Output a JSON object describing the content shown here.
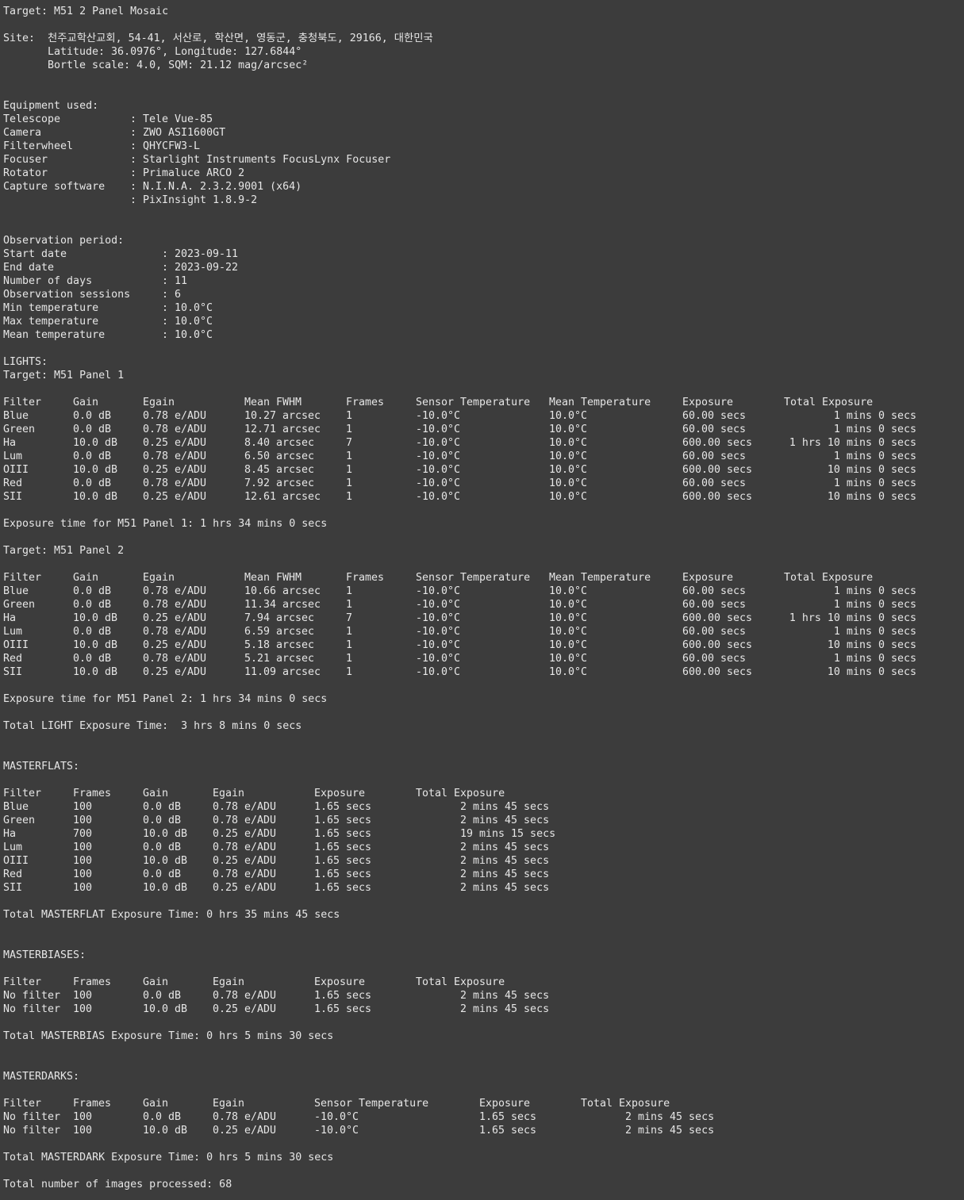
{
  "target_line": "Target: M51 2 Panel Mosaic",
  "site": {
    "label": "Site:",
    "address": "천주교학산교회, 54-41, 서산로, 학산면, 영동군, 충청북도, 29166, 대한민국",
    "coords": "Latitude: 36.0976°, Longitude: 127.6844°",
    "bortle": "Bortle scale: 4.0, SQM: 21.12 mag/arcsec²"
  },
  "equipment": {
    "heading": "Equipment used:",
    "items": [
      {
        "label": "Telescope",
        "value": ": Tele Vue-85"
      },
      {
        "label": "Camera",
        "value": ": ZWO ASI1600GT"
      },
      {
        "label": "Filterwheel",
        "value": ": QHYCFW3-L"
      },
      {
        "label": "Focuser",
        "value": ": Starlight Instruments FocusLynx Focuser"
      },
      {
        "label": "Rotator",
        "value": ": Primaluce ARCO 2"
      },
      {
        "label": "Capture software",
        "value": ": N.I.N.A. 2.3.2.9001 (x64)"
      },
      {
        "label": "",
        "value": ": PixInsight 1.8.9-2"
      }
    ]
  },
  "observation": {
    "heading": "Observation period:",
    "items": [
      {
        "label": "Start date",
        "value": ": 2023-09-11"
      },
      {
        "label": "End date",
        "value": ": 2023-09-22"
      },
      {
        "label": "Number of days",
        "value": ": 11"
      },
      {
        "label": "Observation sessions",
        "value": ": 6"
      },
      {
        "label": "Min temperature",
        "value": ": 10.0°C"
      },
      {
        "label": "Max temperature",
        "value": ": 10.0°C"
      },
      {
        "label": "Mean temperature",
        "value": ": 10.0°C"
      }
    ]
  },
  "lights": {
    "heading": "LIGHTS:",
    "headers": [
      "Filter",
      "Gain",
      "Egain",
      "Mean FWHM",
      "Frames",
      "Sensor Temperature",
      "Mean Temperature",
      "Exposure",
      "Total Exposure"
    ],
    "panels": [
      {
        "target": "Target: M51 Panel 1",
        "rows": [
          [
            "Blue",
            "0.0 dB",
            "0.78 e/ADU",
            "10.27 arcsec",
            "1",
            "-10.0°C",
            "10.0°C",
            "60.00 secs",
            "1 mins 0 secs"
          ],
          [
            "Green",
            "0.0 dB",
            "0.78 e/ADU",
            "12.71 arcsec",
            "1",
            "-10.0°C",
            "10.0°C",
            "60.00 secs",
            "1 mins 0 secs"
          ],
          [
            "Ha",
            "10.0 dB",
            "0.25 e/ADU",
            "8.40 arcsec",
            "7",
            "-10.0°C",
            "10.0°C",
            "600.00 secs",
            "1 hrs 10 mins 0 secs"
          ],
          [
            "Lum",
            "0.0 dB",
            "0.78 e/ADU",
            "6.50 arcsec",
            "1",
            "-10.0°C",
            "10.0°C",
            "60.00 secs",
            "1 mins 0 secs"
          ],
          [
            "OIII",
            "10.0 dB",
            "0.25 e/ADU",
            "8.45 arcsec",
            "1",
            "-10.0°C",
            "10.0°C",
            "600.00 secs",
            "10 mins 0 secs"
          ],
          [
            "Red",
            "0.0 dB",
            "0.78 e/ADU",
            "7.92 arcsec",
            "1",
            "-10.0°C",
            "10.0°C",
            "60.00 secs",
            "1 mins 0 secs"
          ],
          [
            "SII",
            "10.0 dB",
            "0.25 e/ADU",
            "12.61 arcsec",
            "1",
            "-10.0°C",
            "10.0°C",
            "600.00 secs",
            "10 mins 0 secs"
          ]
        ],
        "exposure_line": "Exposure time for M51 Panel 1: 1 hrs 34 mins 0 secs"
      },
      {
        "target": "Target: M51 Panel 2",
        "rows": [
          [
            "Blue",
            "0.0 dB",
            "0.78 e/ADU",
            "10.66 arcsec",
            "1",
            "-10.0°C",
            "10.0°C",
            "60.00 secs",
            "1 mins 0 secs"
          ],
          [
            "Green",
            "0.0 dB",
            "0.78 e/ADU",
            "11.34 arcsec",
            "1",
            "-10.0°C",
            "10.0°C",
            "60.00 secs",
            "1 mins 0 secs"
          ],
          [
            "Ha",
            "10.0 dB",
            "0.25 e/ADU",
            "7.94 arcsec",
            "7",
            "-10.0°C",
            "10.0°C",
            "600.00 secs",
            "1 hrs 10 mins 0 secs"
          ],
          [
            "Lum",
            "0.0 dB",
            "0.78 e/ADU",
            "6.59 arcsec",
            "1",
            "-10.0°C",
            "10.0°C",
            "60.00 secs",
            "1 mins 0 secs"
          ],
          [
            "OIII",
            "10.0 dB",
            "0.25 e/ADU",
            "5.18 arcsec",
            "1",
            "-10.0°C",
            "10.0°C",
            "600.00 secs",
            "10 mins 0 secs"
          ],
          [
            "Red",
            "0.0 dB",
            "0.78 e/ADU",
            "5.21 arcsec",
            "1",
            "-10.0°C",
            "10.0°C",
            "60.00 secs",
            "1 mins 0 secs"
          ],
          [
            "SII",
            "10.0 dB",
            "0.25 e/ADU",
            "11.09 arcsec",
            "1",
            "-10.0°C",
            "10.0°C",
            "600.00 secs",
            "10 mins 0 secs"
          ]
        ],
        "exposure_line": "Exposure time for M51 Panel 2: 1 hrs 34 mins 0 secs"
      }
    ],
    "total_line": "Total LIGHT Exposure Time:  3 hrs 8 mins 0 secs"
  },
  "masterflats": {
    "heading": "MASTERFLATS:",
    "headers": [
      "Filter",
      "Frames",
      "Gain",
      "Egain",
      "Exposure",
      "Total Exposure"
    ],
    "rows": [
      [
        "Blue",
        "100",
        "0.0 dB",
        "0.78 e/ADU",
        "1.65 secs",
        "2 mins 45 secs"
      ],
      [
        "Green",
        "100",
        "0.0 dB",
        "0.78 e/ADU",
        "1.65 secs",
        "2 mins 45 secs"
      ],
      [
        "Ha",
        "700",
        "10.0 dB",
        "0.25 e/ADU",
        "1.65 secs",
        "19 mins 15 secs"
      ],
      [
        "Lum",
        "100",
        "0.0 dB",
        "0.78 e/ADU",
        "1.65 secs",
        "2 mins 45 secs"
      ],
      [
        "OIII",
        "100",
        "10.0 dB",
        "0.25 e/ADU",
        "1.65 secs",
        "2 mins 45 secs"
      ],
      [
        "Red",
        "100",
        "0.0 dB",
        "0.78 e/ADU",
        "1.65 secs",
        "2 mins 45 secs"
      ],
      [
        "SII",
        "100",
        "10.0 dB",
        "0.25 e/ADU",
        "1.65 secs",
        "2 mins 45 secs"
      ]
    ],
    "total_line": "Total MASTERFLAT Exposure Time: 0 hrs 35 mins 45 secs"
  },
  "masterbiases": {
    "heading": "MASTERBIASES:",
    "headers": [
      "Filter",
      "Frames",
      "Gain",
      "Egain",
      "Exposure",
      "Total Exposure"
    ],
    "rows": [
      [
        "No filter",
        "100",
        "0.0 dB",
        "0.78 e/ADU",
        "1.65 secs",
        "2 mins 45 secs"
      ],
      [
        "No filter",
        "100",
        "10.0 dB",
        "0.25 e/ADU",
        "1.65 secs",
        "2 mins 45 secs"
      ]
    ],
    "total_line": "Total MASTERBIAS Exposure Time: 0 hrs 5 mins 30 secs"
  },
  "masterdarks": {
    "heading": "MASTERDARKS:",
    "headers": [
      "Filter",
      "Frames",
      "Gain",
      "Egain",
      "Sensor Temperature",
      "Exposure",
      "Total Exposure"
    ],
    "rows": [
      [
        "No filter",
        "100",
        "0.0 dB",
        "0.78 e/ADU",
        "-10.0°C",
        "1.65 secs",
        "2 mins 45 secs"
      ],
      [
        "No filter",
        "100",
        "10.0 dB",
        "0.25 e/ADU",
        "-10.0°C",
        "1.65 secs",
        "2 mins 45 secs"
      ]
    ],
    "total_line": "Total MASTERDARK Exposure Time: 0 hrs 5 mins 30 secs"
  },
  "summary_line": "Total number of images processed: 68"
}
